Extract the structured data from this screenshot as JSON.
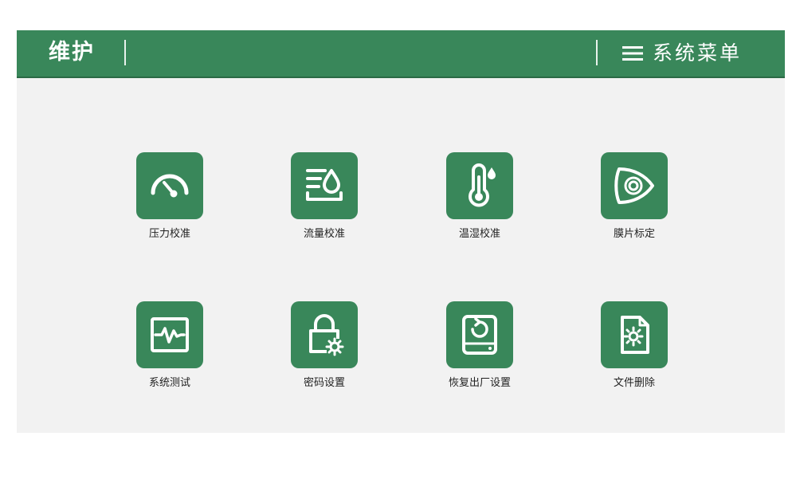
{
  "header": {
    "title": "维护",
    "menu_label": "系统菜单"
  },
  "tiles": [
    {
      "label": "压力校准",
      "icon": "gauge-icon"
    },
    {
      "label": "流量校准",
      "icon": "flow-icon"
    },
    {
      "label": "温湿校准",
      "icon": "thermometer-icon"
    },
    {
      "label": "膜片标定",
      "icon": "diaphragm-icon"
    },
    {
      "label": "系统测试",
      "icon": "waveform-icon"
    },
    {
      "label": "密码设置",
      "icon": "lock-gear-icon"
    },
    {
      "label": "恢复出厂设置",
      "icon": "restore-drive-icon"
    },
    {
      "label": "文件删除",
      "icon": "file-gear-icon"
    }
  ],
  "colors": {
    "accent": "#39875a",
    "background": "#f2f2f2"
  }
}
